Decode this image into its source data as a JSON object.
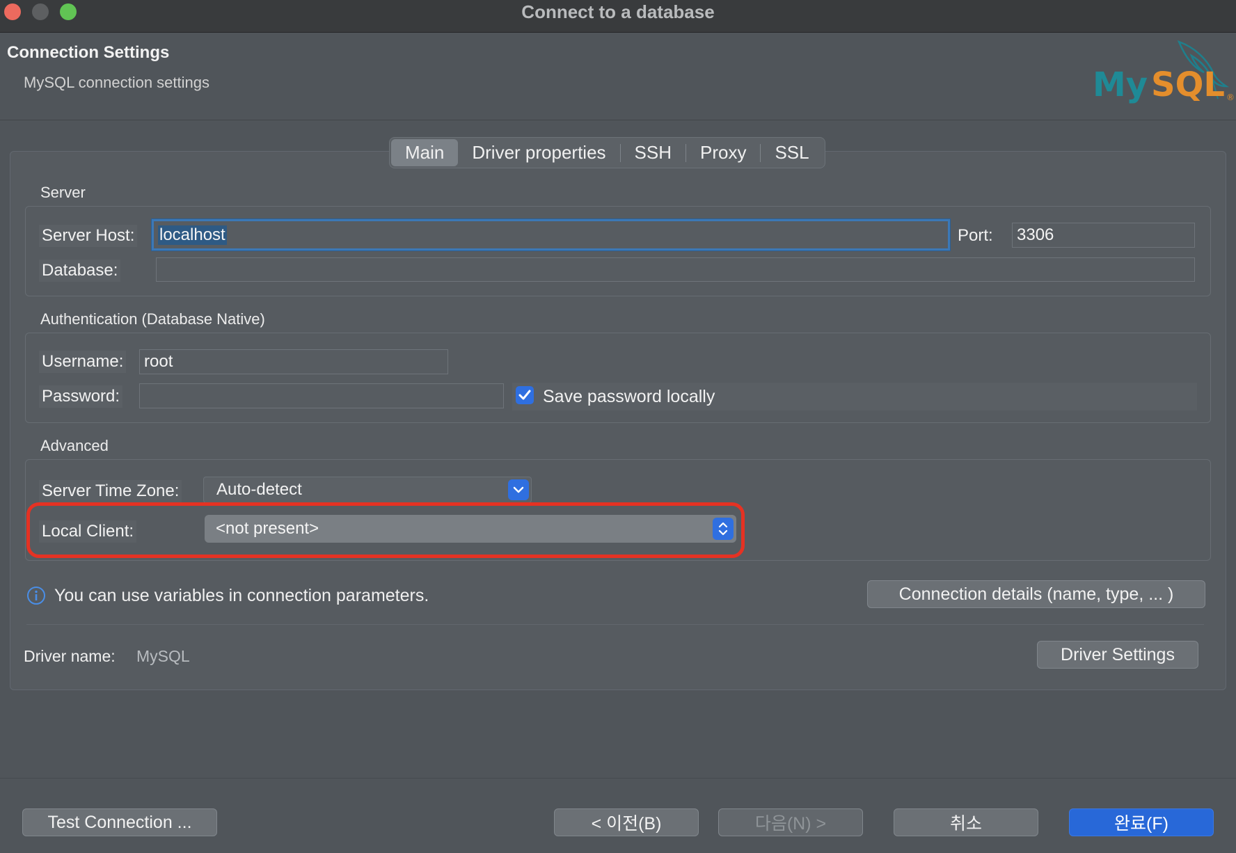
{
  "window": {
    "title": "Connect to a database"
  },
  "header": {
    "title": "Connection Settings",
    "subtitle": "MySQL connection settings",
    "logo_text": "MySQL"
  },
  "tabs": [
    {
      "label": "Main",
      "selected": true
    },
    {
      "label": "Driver properties"
    },
    {
      "label": "SSH"
    },
    {
      "label": "Proxy"
    },
    {
      "label": "SSL"
    }
  ],
  "server": {
    "group_label": "Server",
    "host_label": "Server Host:",
    "host_value": "localhost",
    "port_label": "Port:",
    "port_value": "3306",
    "database_label": "Database:",
    "database_value": ""
  },
  "auth": {
    "group_label": "Authentication (Database Native)",
    "username_label": "Username:",
    "username_value": "root",
    "password_label": "Password:",
    "password_value": "",
    "save_password_label": "Save password locally",
    "save_password_checked": true
  },
  "advanced": {
    "group_label": "Advanced",
    "timezone_label": "Server Time Zone:",
    "timezone_value": "Auto-detect",
    "local_client_label": "Local Client:",
    "local_client_value": "<not present>"
  },
  "info": {
    "text": "You can use variables in connection parameters.",
    "connection_details_button": "Connection details (name, type, ... )"
  },
  "driver": {
    "label": "Driver name:",
    "value": "MySQL",
    "settings_button": "Driver Settings"
  },
  "footer": {
    "test_connection": "Test Connection ...",
    "back": "< 이전(B)",
    "next": "다음(N) >",
    "cancel": "취소",
    "finish": "완료(F)"
  },
  "colors": {
    "accent": "#2f6fe0",
    "highlight_ring": "#e53223",
    "focus_ring": "#3c78b6",
    "mysql_teal": "#1f8a96",
    "mysql_orange": "#e48e2c"
  }
}
